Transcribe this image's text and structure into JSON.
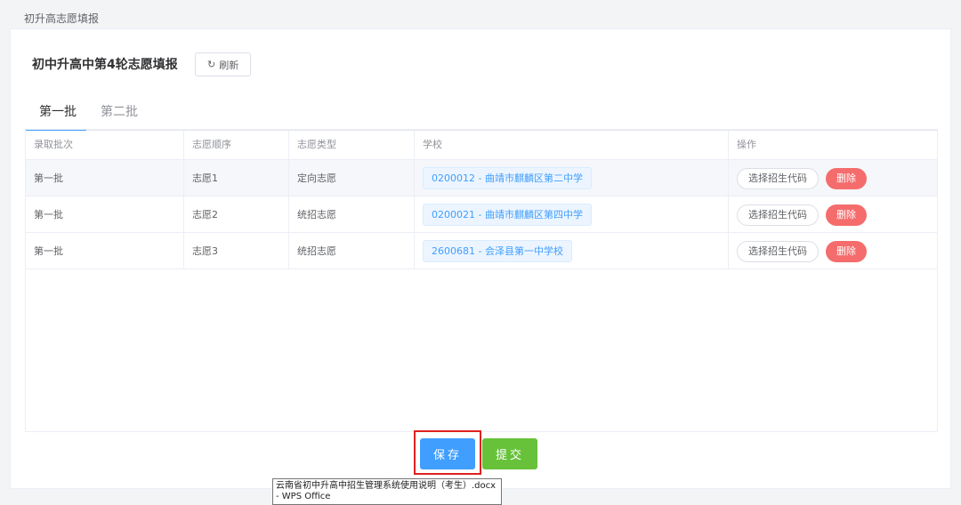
{
  "breadcrumb": "初升高志愿填报",
  "header": {
    "title": "初中升高中第4轮志愿填报",
    "refresh_label": "刷新"
  },
  "tabs": [
    {
      "label": "第一批",
      "active": true
    },
    {
      "label": "第二批",
      "active": false
    }
  ],
  "table": {
    "columns": [
      "录取批次",
      "志愿顺序",
      "志愿类型",
      "学校",
      "操作"
    ],
    "rows": [
      {
        "batch": "第一批",
        "order": "志愿1",
        "type": "定向志愿",
        "school": "0200012 - 曲靖市麒麟区第二中学",
        "select_code": "选择招生代码",
        "delete": "删除"
      },
      {
        "batch": "第一批",
        "order": "志愿2",
        "type": "统招志愿",
        "school": "0200021 - 曲靖市麒麟区第四中学",
        "select_code": "选择招生代码",
        "delete": "删除"
      },
      {
        "batch": "第一批",
        "order": "志愿3",
        "type": "统招志愿",
        "school": "2600681 - 会泽县第一中学校",
        "select_code": "选择招生代码",
        "delete": "删除"
      }
    ]
  },
  "actions": {
    "save_label": "保存",
    "submit_label": "提交"
  },
  "tooltip": {
    "line1": "云南省初中升高中招生管理系统使用说明（考生）.docx",
    "line2": "- WPS Office"
  },
  "colors": {
    "primary": "#409eff",
    "success": "#67c23a",
    "danger": "#f56c6c",
    "highlight_box": "#e02020"
  }
}
